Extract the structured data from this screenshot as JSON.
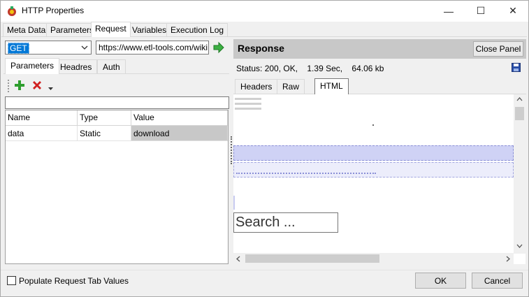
{
  "window": {
    "title": "HTTP Properties",
    "min_glyph": "—",
    "max_glyph": "☐",
    "close_glyph": "✕"
  },
  "main_tabs": [
    "Meta Data",
    "Parameters",
    "Request",
    "Variables",
    "Execution Log"
  ],
  "request": {
    "method": "GET",
    "url": "https://www.etl-tools.com/wiki",
    "sub_tabs": [
      "Parameters",
      "Headres",
      "Auth"
    ],
    "grid": {
      "columns": [
        "Name",
        "Type",
        "Value"
      ],
      "rows": [
        {
          "name": "data",
          "type": "Static",
          "value": "download"
        }
      ]
    }
  },
  "response": {
    "title": "Response",
    "close_label": "Close Panel",
    "status": "Status: 200, OK,    1.39 Sec,    64.06 kb",
    "tabs": [
      "Headers",
      "Raw",
      "HTML"
    ],
    "search_placeholder": "Search ..."
  },
  "footer": {
    "populate_label": "Populate Request Tab Values",
    "ok_label": "OK",
    "cancel_label": "Cancel"
  },
  "colors": {
    "accent": "#0078d7",
    "add": "#2e9e2e",
    "delete": "#d02020",
    "go_arrow": "#3cb043"
  }
}
